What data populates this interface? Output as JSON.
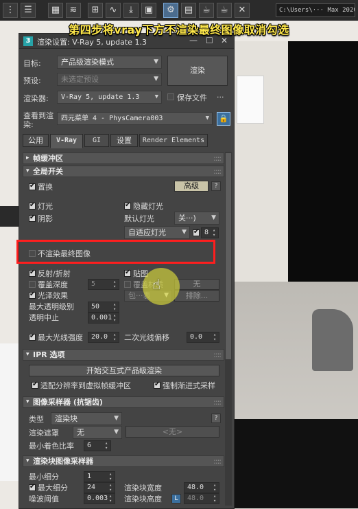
{
  "caption": "第四步将vray下方不渲染最终图像取消勾选",
  "toolbar": {
    "path_text": "C:\\Users\\··· Max 2020"
  },
  "dialog": {
    "title_icon": "3",
    "title": "渲染设置: V-Ray 5, update 1.3",
    "close": "✕",
    "target_label": "目标:",
    "target_value": "产品级渲染模式",
    "preset_label": "预设:",
    "preset_value": "未选定预设",
    "renderer_label": "渲染器:",
    "renderer_value": "V-Ray 5, update 1.3",
    "save_file_label": "保存文件",
    "more": "...",
    "render_button": "渲染",
    "view_label_1": "查看到渲",
    "view_label_2": "染:",
    "view_value": "四元菜单 4 - PhysCamera003"
  },
  "tabs": [
    {
      "label": "公用"
    },
    {
      "label": "V-Ray"
    },
    {
      "label": "GI"
    },
    {
      "label": "设置"
    },
    {
      "label": "Render Elements"
    }
  ],
  "rollouts": {
    "frame_buffer": "帧缓冲区",
    "global_switches": "全局开关",
    "ipr": "IPR 选项",
    "image_sampler": "图像采样器 (抗锯齿)",
    "bucket_sampler": "渲染块图像采样器",
    "grip": "::::"
  },
  "global": {
    "displacement": "置换",
    "advanced": "高级",
    "help": "?",
    "lights": "灯光",
    "hidden_lights": "隐藏灯光",
    "shadows": "阴影",
    "default_lights_label": "默认灯光",
    "default_lights_value": "关···)",
    "adaptive_lights": "自适应灯光",
    "adaptive_lights_count": "8",
    "dont_render_final": "不渲染最终图像",
    "reflection": "反射/折射",
    "maps": "贴图",
    "override_depth": "覆盖深度",
    "override_depth_value": "5",
    "override_mtl": "覆盖材质",
    "override_mtl_value": "无",
    "glossy": "光泽效果",
    "include_value": "包···表",
    "exclude": "排除...",
    "max_transp_label": "最大透明级别",
    "max_transp_value": "50",
    "transp_cutoff_label": "透明中止",
    "transp_cutoff_value": "0.001",
    "max_ray_intensity": "最大光线强度",
    "max_ray_value": "20.0",
    "secondary_bias_label": "二次光线偏移",
    "secondary_bias_value": "0.0"
  },
  "ipr": {
    "start_button": "开始交互式产品级渲染",
    "fit_resolution": "适配分辨率到虚拟帧缓冲区",
    "force_progressive": "强制渐进式采样"
  },
  "sampler": {
    "type_label": "类型",
    "type_value": "渲染块",
    "mask_label": "渲染遮罩",
    "mask_value": "无",
    "mask_none": "<无>",
    "min_shading_label": "最小着色比率",
    "min_shading_value": "6"
  },
  "bucket": {
    "min_subdiv_label": "最小细分",
    "min_subdiv_value": "1",
    "max_subdiv_label": "最大细分",
    "max_subdiv_value": "24",
    "bucket_width_label": "渲染块宽度",
    "bucket_width_value": "48.0",
    "noise_label": "噪波阈值",
    "noise_value": "0.003",
    "bucket_height_label": "渲染块高度",
    "bucket_height_lock": "L",
    "bucket_height_value": "48.0"
  }
}
